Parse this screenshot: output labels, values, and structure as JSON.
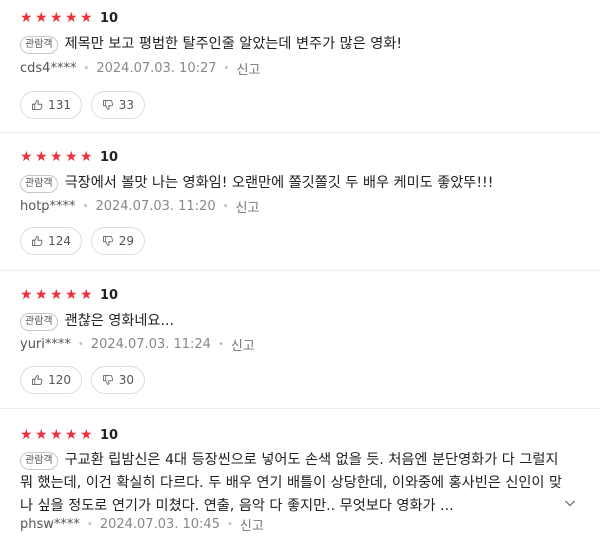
{
  "reviews": [
    {
      "score": "10",
      "badge": "관람객",
      "comment": "제목만 보고 평범한 탈주인줄 알았는데 변주가 많은 영화!",
      "user": "cds4****",
      "date": "2024.07.03. 10:27",
      "report": "신고",
      "likes": "131",
      "dislikes": "33"
    },
    {
      "score": "10",
      "badge": "관람객",
      "comment": "극장에서 볼맛 나는 영화임! 오랜만에 쫄깃쫄깃 두 배우 케미도 좋았뚜!!!",
      "user": "hotp****",
      "date": "2024.07.03. 11:20",
      "report": "신고",
      "likes": "124",
      "dislikes": "29"
    },
    {
      "score": "10",
      "badge": "관람객",
      "comment": "괜찮은 영화네요...",
      "user": "yuri****",
      "date": "2024.07.03. 11:24",
      "report": "신고",
      "likes": "120",
      "dislikes": "30"
    },
    {
      "score": "10",
      "badge": "관람객",
      "comment": "구교환 립밤신은 4대 등장씬으로 넣어도 손색 없을 듯. 처음엔 분단영화가 다 그럴지뭐 했는데, 이건 확실히 다르다. 두 배우 연기 배틀이 상당한데, 이와중에 홍사빈은 신인이 맞나 싶을 정도로 연기가 미쳤다. 연출, 음악 다 좋지만.. 무엇보다 영화가 ...",
      "user": "phsw****",
      "date": "2024.07.03. 10:45",
      "report": "신고",
      "likes": "",
      "dislikes": ""
    }
  ],
  "icons": {
    "star": "star-icon",
    "like": "thumbs-up-icon",
    "dislike": "thumbs-down-icon",
    "expand": "chevron-down-icon"
  },
  "colors": {
    "star": "#f02e3c",
    "text": "#222222",
    "meta": "#888888",
    "border": "#dcdcdc"
  }
}
